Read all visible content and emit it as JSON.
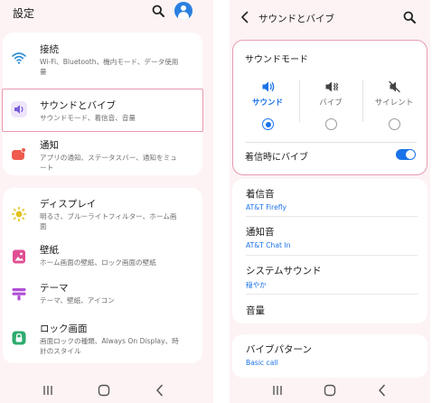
{
  "left": {
    "title": "設定",
    "items": [
      {
        "title": "接続",
        "subtitle": "Wi-Fi、Bluetooth、機内モード、データ使用量"
      },
      {
        "title": "サウンドとバイブ",
        "subtitle": "サウンドモード、着信音、音量"
      },
      {
        "title": "通知",
        "subtitle": "アプリの通知、ステータスバー、通知をミュート"
      },
      {
        "title": "ディスプレイ",
        "subtitle": "明るさ、ブルーライトフィルター、ホーム画面"
      },
      {
        "title": "壁紙",
        "subtitle": "ホーム画面の壁紙、ロック画面の壁紙"
      },
      {
        "title": "テーマ",
        "subtitle": "テーマ、壁紙、アイコン"
      },
      {
        "title": "ロック画面",
        "subtitle": "画面ロックの種類、Always On Display、時計のスタイル"
      }
    ]
  },
  "right": {
    "title": "サウンドとバイブ",
    "sound_mode": {
      "heading": "サウンドモード",
      "options": [
        "サウンド",
        "バイブ",
        "サイレント"
      ],
      "selected": "サウンド"
    },
    "vibrate_on_ring": {
      "label": "着信時にバイブ",
      "on": true
    },
    "items": [
      {
        "title": "着信音",
        "subtitle": "AT&T Firefly"
      },
      {
        "title": "通知音",
        "subtitle": "AT&T Chat In"
      },
      {
        "title": "システムサウンド",
        "subtitle": "穏やか"
      },
      {
        "title": "音量"
      }
    ],
    "vibration_pattern": {
      "title": "バイブパターン",
      "subtitle": "Basic call"
    }
  },
  "colors": {
    "accent": "#1a73e8",
    "highlight_border": "#e89ab0",
    "background": "#fdf3f4"
  },
  "icons": [
    "search-icon",
    "account-icon",
    "wifi-icon",
    "speaker-icon",
    "notification-icon",
    "display-icon",
    "wallpaper-icon",
    "theme-icon",
    "lock-icon",
    "back-icon",
    "vibrate-icon",
    "mute-icon",
    "recents-icon",
    "home-icon",
    "nav-back-icon"
  ]
}
